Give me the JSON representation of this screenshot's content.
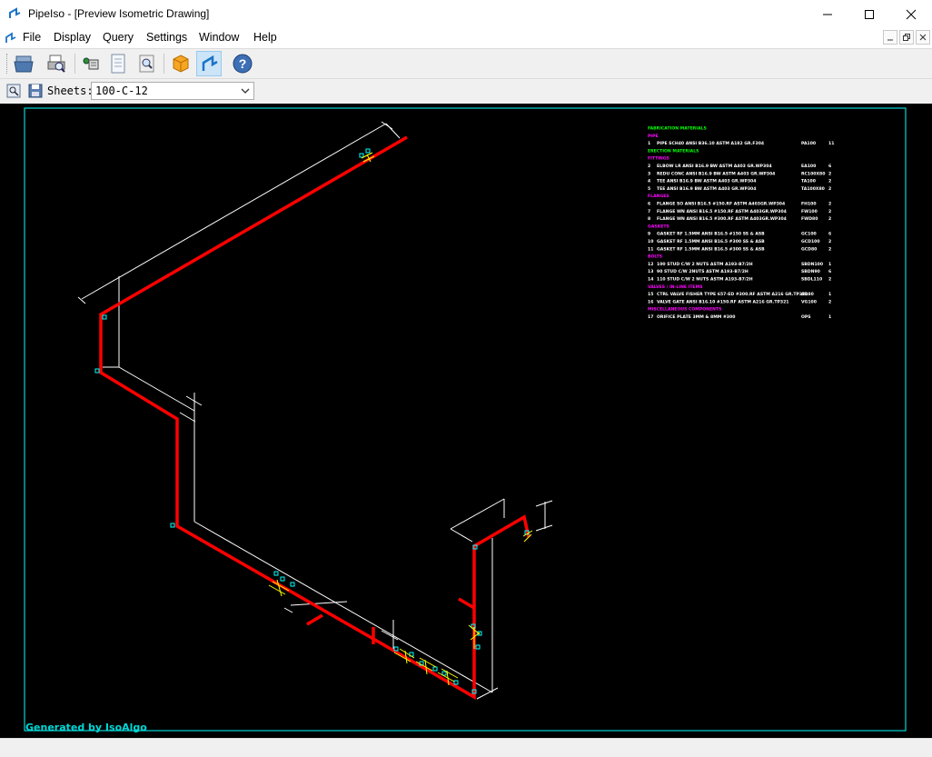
{
  "window": {
    "title": "PipeIso - [Preview Isometric Drawing]",
    "minimize_glyph": "—",
    "maximize_glyph": "☐",
    "close_glyph": "✕"
  },
  "menu": [
    "File",
    "Display",
    "Query",
    "Settings",
    "Window",
    "Help"
  ],
  "toolbar": {
    "buttons": [
      "open-file-icon",
      "print-preview-icon",
      "connect-icon",
      "document-icon",
      "find-icon",
      "3d-box-icon",
      "isometric-icon",
      "help-icon"
    ],
    "active": "isometric-icon"
  },
  "sheets": {
    "label": "Sheets:",
    "selected": "100-C-12"
  },
  "drawing": {
    "footer": "Generated by IsoAlgo",
    "colors": {
      "pipe": "#ff0000",
      "dimension": "#ffffff",
      "frame": "#00ffff",
      "component": "#ffff00",
      "header": "#00ff00",
      "section": "#ff00ff"
    },
    "bom": [
      {
        "kind": "header",
        "text": "FABRICATION MATERIALS"
      },
      {
        "kind": "section",
        "text": "PIPE"
      },
      {
        "kind": "item",
        "no": "1",
        "desc": "PIPE SCH40 ANSI B36.10 ASTM A182 GR.F304",
        "code": "PA100",
        "qty": "11"
      },
      {
        "kind": "header",
        "text": "ERECTION MATERIALS"
      },
      {
        "kind": "section",
        "text": "FITTINGS"
      },
      {
        "kind": "item",
        "no": "2",
        "desc": "ELBOW LR ANSI B16.9 BW ASTM A403 GR.WP304",
        "code": "EA100",
        "qty": "6"
      },
      {
        "kind": "item",
        "no": "3",
        "desc": "REDU CONC ANSI B16.9 BW ASTM A403 GR.WP304",
        "code": "RC100X80",
        "qty": "2"
      },
      {
        "kind": "item",
        "no": "4",
        "desc": "TEE ANSI B16.9 BW ASTM A403 GR.WP304",
        "code": "TA100",
        "qty": "2"
      },
      {
        "kind": "item",
        "no": "5",
        "desc": "TEE ANSI B16.9 BW ASTM A403 GR.WP304",
        "code": "TA100X80",
        "qty": "2"
      },
      {
        "kind": "section",
        "text": "FLANGES"
      },
      {
        "kind": "item",
        "no": "6",
        "desc": "FLANGE SO ANSI B16.5 #150.RF ASTM A403GR.WP304",
        "code": "FH100",
        "qty": "2"
      },
      {
        "kind": "item",
        "no": "7",
        "desc": "FLANGE WN ANSI B16.5 #150.RF ASTM A403GR.WP304",
        "code": "FW100",
        "qty": "2"
      },
      {
        "kind": "item",
        "no": "8",
        "desc": "FLANGE WN ANSI B16.5 #300.RF ASTM A403GR.WP304",
        "code": "FWD80",
        "qty": "2"
      },
      {
        "kind": "section",
        "text": "GASKETS"
      },
      {
        "kind": "item",
        "no": "9",
        "desc": "GASKET RF 1.5MM ANSI B16.5 #150 SS & ASB",
        "code": "GC100",
        "qty": "6"
      },
      {
        "kind": "item",
        "no": "10",
        "desc": "GASKET RF 1.5MM ANSI B16.5 #300 SS & ASB",
        "code": "GCD100",
        "qty": "2"
      },
      {
        "kind": "item",
        "no": "11",
        "desc": "GASKET RF 1.5MM ANSI B16.5 #300 SS & ASB",
        "code": "GCD80",
        "qty": "2"
      },
      {
        "kind": "section",
        "text": "BOLTS"
      },
      {
        "kind": "item",
        "no": "12",
        "desc": "100 STUD C/W 2 NUTS ASTM A193-B7/2H",
        "code": "SBDN100",
        "qty": "1"
      },
      {
        "kind": "item",
        "no": "13",
        "desc": "90 STUD C/W 2NUTS ASTM A193-B7/2H",
        "code": "SBDN90",
        "qty": "6"
      },
      {
        "kind": "item",
        "no": "14",
        "desc": "110 STUD C/W 2 NUTS ASTM A193-B7/2H",
        "code": "SBDL110",
        "qty": "2"
      },
      {
        "kind": "section",
        "text": "VALVES / IN-LINE ITEMS"
      },
      {
        "kind": "item",
        "no": "15",
        "desc": "CTRL VALVE FISHER TYPE 657-ED #300.RF ASTM A216 GR.TP321",
        "code": "AD80",
        "qty": "1"
      },
      {
        "kind": "item",
        "no": "16",
        "desc": "VALVE GATE ANSI B16.10 #150.RF ASTM A216 GR.TP321",
        "code": "VG100",
        "qty": "2"
      },
      {
        "kind": "section",
        "text": "MISCELLANEOUS COMPONENTS"
      },
      {
        "kind": "item",
        "no": "17",
        "desc": "ORIFICE PLATE 3MM & 8MM #300",
        "code": "OPS",
        "qty": "1"
      }
    ]
  }
}
